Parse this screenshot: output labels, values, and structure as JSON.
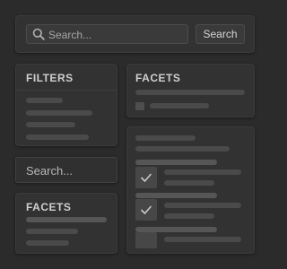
{
  "search_bar": {
    "placeholder": "Search...",
    "button_label": "Search",
    "icon": "search-icon"
  },
  "filters_panel": {
    "title": "FILTERS"
  },
  "facets_panel_top": {
    "title": "FACETS"
  },
  "sidebar_search": {
    "placeholder": "Search..."
  },
  "facets_panel_bottom": {
    "title": "FACETS"
  },
  "results_panel": {
    "items": [
      {
        "checked": true
      },
      {
        "checked": true
      },
      {
        "checked": false
      }
    ]
  },
  "colors": {
    "background": "#2b2b2b",
    "panel": "#323232",
    "skeleton": "#4a4a4a",
    "text": "#cfcfcf"
  }
}
